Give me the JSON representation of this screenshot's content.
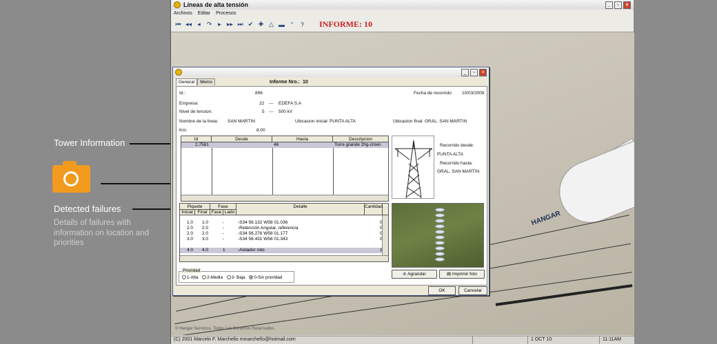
{
  "annotations": {
    "tower": "Tower Information",
    "failures_title": "Detected failures",
    "failures_desc": "Details of failures with information on location and priorities"
  },
  "app": {
    "title": "Líneas de alta tensión",
    "menu": [
      "Archivos",
      "Editar",
      "Procesos"
    ],
    "informe_label": "INFORME: 10",
    "copyright": "© Hangar Servicios. Todos Los Derechos Reservados.",
    "statusbar": [
      "(C) 2001 Marcelo F. Marchello mmarchello@hotmail.com",
      "1 OCT 10",
      "11:11AM"
    ],
    "desktop_brand": "HANGAR"
  },
  "dialog": {
    "tabs": [
      "General",
      "Memo"
    ],
    "informe_nro_label": "Informe Nro.:",
    "informe_nro": "10",
    "id_label": "Id.:",
    "id": "896",
    "fecha_label": "Fecha de recorrido:",
    "fecha": "10/03/2009",
    "empresa_label": "Empresa:",
    "empresa_code": "22",
    "empresa_name": "EDEFA S.A",
    "nivel_label": "Nivel de tension:",
    "nivel_code": "5",
    "nivel_value": "500 kV",
    "sep": "---",
    "linea_label": "Nombre de la linea:",
    "linea": "SAN MARTIN",
    "ubic_ini_label": "Ubicacion inicial:",
    "ubic_ini": "PUNTA ALTA",
    "ubic_fin_label": "Ubicacion final:",
    "ubic_fin": "GRAL. SAN MARTIN",
    "km_label": "Km:",
    "km": "8.00",
    "tower_grid": {
      "headers": [
        "Id",
        "Desde",
        "Hasta",
        "Descripcion"
      ],
      "rows": [
        [
          "2.7581",
          "",
          "46",
          "Torre grande 2hg-cmen"
        ]
      ]
    },
    "recorrido_desde_label": "Recorrido desde:",
    "recorrido_desde": "PUNTA ALTA",
    "recorrido_hasta_label": "Recorrido hasta:",
    "recorrido_hasta": "GRAL. SAN MARTIN",
    "fail_grid": {
      "group_piquete": "Piquete",
      "group_fase": "Fase",
      "headers": [
        "Inicial",
        "Final",
        "Fase",
        "Lado",
        "Detalle",
        "Cantidad"
      ],
      "rows": [
        [
          "1.0",
          "1.0",
          "-",
          "",
          "-S34 56.132 W58 01.036",
          "0"
        ],
        [
          "2.0",
          "2.0",
          "-",
          "",
          "-Retención Angular, referencia",
          "0"
        ],
        [
          "2.0",
          "2.0",
          "-",
          "",
          "-S34 56.276 W58 01.177",
          "0"
        ],
        [
          "3.0",
          "3.0",
          "-",
          "",
          "-S34 56.431 W58 01.343",
          "0"
        ],
        [
          "4.0",
          "4.0",
          "1",
          "",
          "-Aislador roto",
          "1"
        ]
      ]
    },
    "prioridad_label": "Prioridad",
    "prioridades": [
      "1-Alta",
      "2-Media",
      "3- Baja",
      "0-Sin prioridad"
    ],
    "agrandar": "Agrandar",
    "imprimir": "Imprimir foto",
    "ok": "OK",
    "cancelar": "Cancelar"
  }
}
